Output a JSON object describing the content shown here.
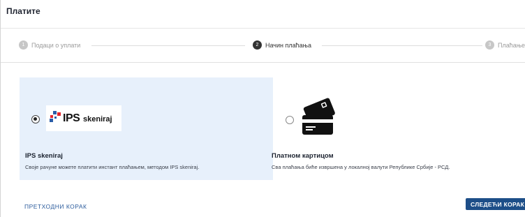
{
  "header": {
    "title": "Платите"
  },
  "stepper": {
    "steps": [
      {
        "number": "1",
        "label": "Подаци о уплати",
        "state": "inactive"
      },
      {
        "number": "2",
        "label": "Начин плаћања",
        "state": "active"
      },
      {
        "number": "3",
        "label": "Плаћање",
        "state": "inactive"
      }
    ]
  },
  "options": {
    "ips": {
      "selected": true,
      "logo_ips": "IPS",
      "logo_skeniraj": "skeniraj",
      "title": "IPS skeniraj",
      "description": "Своје рачуне можете платити инстант плаћањем, методом IPS skeniraj."
    },
    "card": {
      "selected": false,
      "title": "Платном картицом",
      "description": "Сва плаћања биће извршена у локалној валути Републике Србије - РСД."
    }
  },
  "footer": {
    "prev_label": "ПРЕТХОДНИ КОРАК",
    "next_label": "СЛЕДЕЋИ КОРАК"
  },
  "colors": {
    "selected_bg": "#e7f0fb",
    "primary_button": "#1d4e88",
    "link": "#2b5b9c",
    "ips_red": "#e3262d",
    "ips_blue": "#2a5ca8"
  }
}
